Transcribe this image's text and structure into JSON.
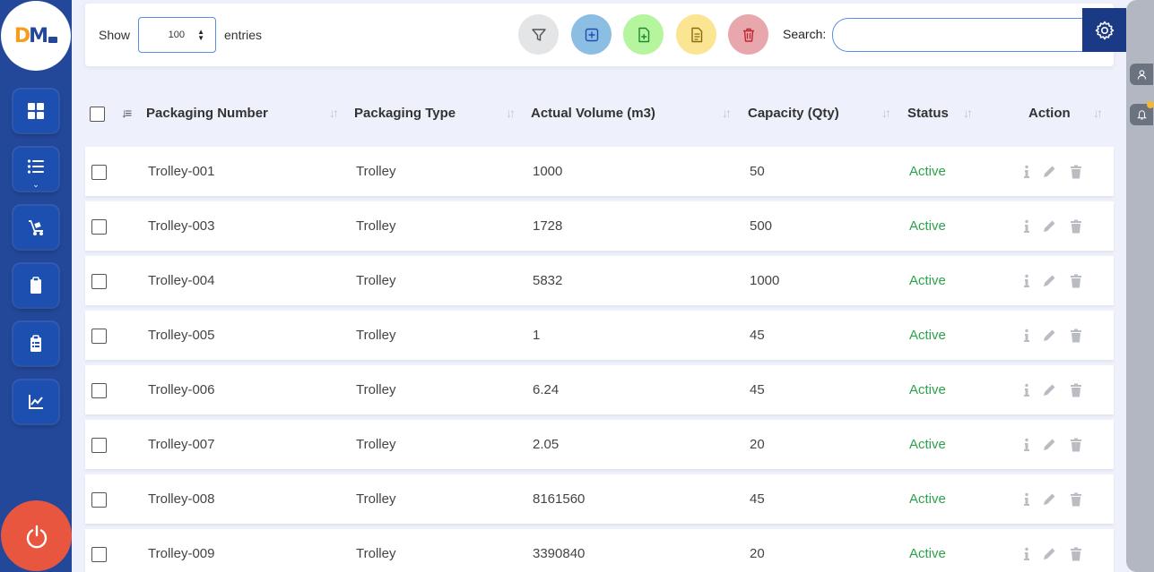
{
  "brand": {
    "logo_d": "D",
    "logo_m": "M"
  },
  "sidebar": {
    "items": [
      {
        "name": "dashboard",
        "icon": "dashboard-icon"
      },
      {
        "name": "list",
        "icon": "list-icon"
      },
      {
        "name": "trolley",
        "icon": "trolley-icon"
      },
      {
        "name": "clipboard",
        "icon": "clipboard-icon"
      },
      {
        "name": "checklist",
        "icon": "checklist-icon"
      },
      {
        "name": "reports",
        "icon": "chart-line-icon"
      }
    ]
  },
  "toolbar": {
    "show_label": "Show",
    "entries_value": "100",
    "entries_label": "entries",
    "search_label": "Search:",
    "search_value": "",
    "buttons": [
      {
        "name": "filter",
        "icon": "filter-icon",
        "color": "#e4e5e7"
      },
      {
        "name": "add",
        "icon": "plus-square-icon",
        "color": "#8cbde3"
      },
      {
        "name": "import",
        "icon": "file-plus-icon",
        "color": "#b5f59e"
      },
      {
        "name": "export",
        "icon": "file-text-icon",
        "color": "#fbe592"
      },
      {
        "name": "delete",
        "icon": "trash-icon",
        "color": "#e7a7ad"
      }
    ]
  },
  "table": {
    "columns": [
      "Packaging Number",
      "Packaging Type",
      "Actual Volume (m3)",
      "Capacity (Qty)",
      "Status",
      "Action"
    ],
    "rows": [
      {
        "number": "Trolley-001",
        "type": "Trolley",
        "volume": "1000",
        "capacity": "50",
        "status": "Active"
      },
      {
        "number": "Trolley-003",
        "type": "Trolley",
        "volume": "1728",
        "capacity": "500",
        "status": "Active"
      },
      {
        "number": "Trolley-004",
        "type": "Trolley",
        "volume": "5832",
        "capacity": "1000",
        "status": "Active"
      },
      {
        "number": "Trolley-005",
        "type": "Trolley",
        "volume": "1",
        "capacity": "45",
        "status": "Active"
      },
      {
        "number": "Trolley-006",
        "type": "Trolley",
        "volume": "6.24",
        "capacity": "45",
        "status": "Active"
      },
      {
        "number": "Trolley-007",
        "type": "Trolley",
        "volume": "2.05",
        "capacity": "20",
        "status": "Active"
      },
      {
        "number": "Trolley-008",
        "type": "Trolley",
        "volume": "8161560",
        "capacity": "45",
        "status": "Active"
      },
      {
        "number": "Trolley-009",
        "type": "Trolley",
        "volume": "3390840",
        "capacity": "20",
        "status": "Active"
      }
    ]
  },
  "colors": {
    "sidebar": "#23489a",
    "accent": "#1a3a86",
    "status_active": "#2ca24a",
    "power": "#e8563f",
    "logo_orange": "#f59d1c"
  }
}
